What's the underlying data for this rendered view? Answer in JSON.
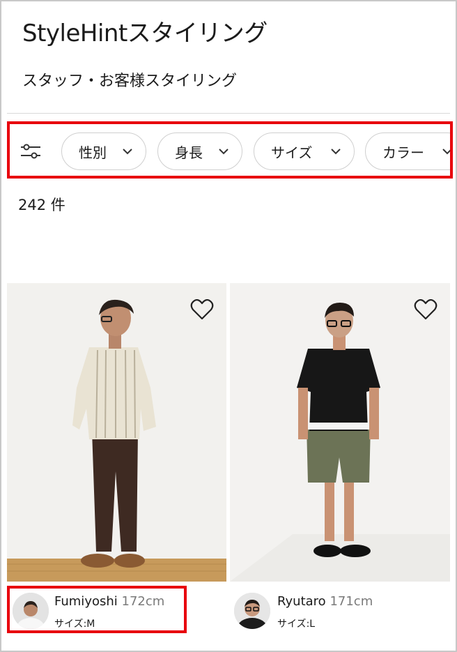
{
  "header": {
    "title": "StyleHintスタイリング",
    "subtitle": "スタッフ・お客様スタイリング"
  },
  "filters": {
    "icon": "filter-sliders-icon",
    "chips": [
      {
        "label": "性別"
      },
      {
        "label": "身長"
      },
      {
        "label": "サイズ"
      },
      {
        "label": "カラー"
      }
    ]
  },
  "results": {
    "count": "242 件"
  },
  "cards": [
    {
      "name": "Fumiyoshi",
      "height": "172cm",
      "size": "サイズ:M",
      "icon": "heart-outline-icon"
    },
    {
      "name": "Ryutaro",
      "height": "171cm",
      "size": "サイズ:L",
      "icon": "heart-outline-icon"
    }
  ],
  "colors": {
    "highlight": "#e8000b",
    "chip_border": "#cfcfcf",
    "muted_text": "#7a7a7a"
  }
}
